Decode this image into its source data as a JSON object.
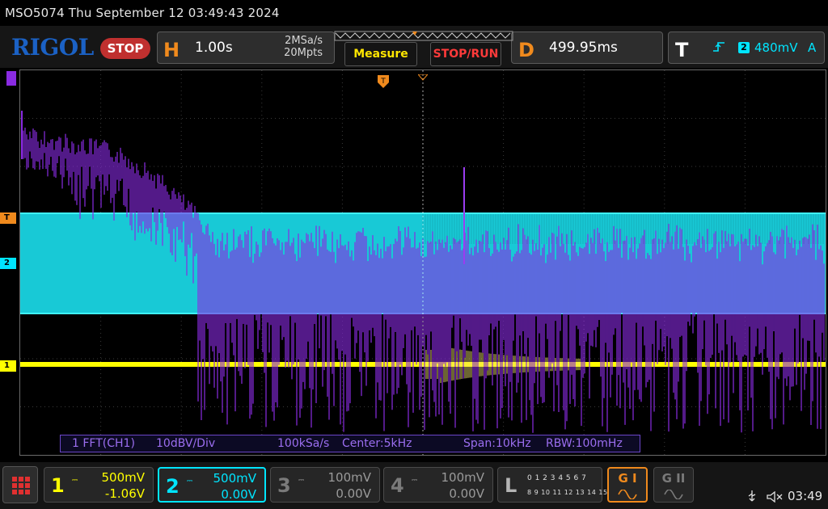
{
  "titlebar": {
    "text": "MSO5074  Thu September 12 03:49:43 2024"
  },
  "header": {
    "logo": "RIGOL",
    "run_state": "STOP",
    "horizontal": {
      "letter": "H",
      "timebase": "1.00s",
      "sample_rate": "2MSa/s",
      "memory_depth": "20Mpts"
    },
    "delay": {
      "letter": "D",
      "value": "499.95ms"
    },
    "trigger": {
      "letter": "T",
      "source": "2",
      "level": "480mV",
      "mode": "A"
    }
  },
  "buttons": {
    "measure": "Measure",
    "stop_run": "STOP/RUN"
  },
  "markers": {
    "trigger_level": "T",
    "ch2": "2",
    "ch1": "1"
  },
  "fft": {
    "label": "1 FFT(CH1)",
    "scale": "10dBV/Div",
    "rate": "100kSa/s",
    "center": "Center:5kHz",
    "span": "Span:10kHz",
    "rbw": "RBW:100mHz"
  },
  "channels": [
    {
      "num": "1",
      "scale": "500mV",
      "offset": "-1.06V",
      "color": "#ffff00"
    },
    {
      "num": "2",
      "scale": "500mV",
      "offset": "0.00V",
      "color": "#00e5ff"
    },
    {
      "num": "3",
      "scale": "100mV",
      "offset": "0.00V",
      "color": "#8a8a8a"
    },
    {
      "num": "4",
      "scale": "100mV",
      "offset": "0.00V",
      "color": "#8a8a8a"
    }
  ],
  "logic": {
    "letter": "L",
    "row1": "0 1 2 3   4 5 6 7",
    "row2": "8 9 10 11  12 13 14 15"
  },
  "gen1": {
    "label": "G I"
  },
  "gen2": {
    "label": "G II"
  },
  "status": {
    "time": "03:49"
  },
  "colors": {
    "accent_orange": "#f08a1d",
    "ch1_yellow": "#ffff00",
    "ch2_cyan": "#00e5ff",
    "fft_purple": "#8a2be2",
    "stop_red": "#c0302f",
    "logo_blue": "#1b61c4"
  }
}
